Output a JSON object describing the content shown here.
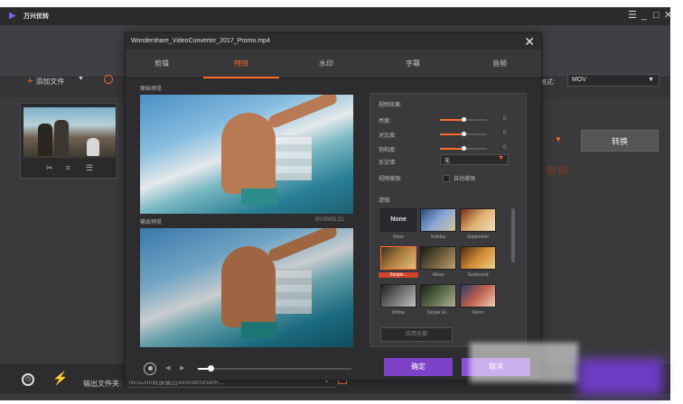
{
  "app": {
    "title": "万兴优转",
    "window_controls": {
      "menu": "☰",
      "minimize": "_",
      "maximize": "□",
      "close": "✕"
    }
  },
  "toolbar": {
    "add_file": "添加文件",
    "output_format_label": "格式:",
    "output_format_value": "MOV"
  },
  "file_item": {
    "convert_label": "转换"
  },
  "bottom": {
    "output_label": "输出文件夹:",
    "output_path": "\\WSOut\\转换输出\\Wondershare\\..."
  },
  "dialog": {
    "title": "Wondershare_VideoConverter_2017_Promo.mp4",
    "close": "✕",
    "tabs": [
      "剪辑",
      "特效",
      "水印",
      "字幕",
      "音频"
    ],
    "original_preview_label": "原始预览",
    "output_preview_label": "输出预览",
    "output_time": "00:00/01:21",
    "playback_progress": 0.08,
    "video_effects_label": "视频效果:",
    "adjustments": [
      {
        "label": "亮度:",
        "value": "0",
        "level": 0.5
      },
      {
        "label": "对比度:",
        "value": "0",
        "level": 0.5
      },
      {
        "label": "饱和度:",
        "value": "0",
        "level": 0.5
      }
    ],
    "deinterlace_label": "反交错:",
    "deinterlace_value": "无",
    "enhance_label": "视频增强:",
    "auto_enhance_label": "自动增强",
    "filter_label": "滤镜:",
    "filters": [
      {
        "name": "None",
        "style": "none"
      },
      {
        "name": "Holiday",
        "style": "holiday"
      },
      {
        "name": "September",
        "style": "september"
      },
      {
        "name": "Simple...",
        "style": "simple",
        "selected": true
      },
      {
        "name": "Aibao",
        "style": "aibao"
      },
      {
        "name": "Sunkissed",
        "style": "sunkissed"
      },
      {
        "name": "Willow",
        "style": "willow"
      },
      {
        "name": "Simple El...",
        "style": "simpleel"
      },
      {
        "name": "Retro",
        "style": "retro"
      }
    ],
    "apply_all_label": "应用全部",
    "ok_label": "确定",
    "cancel_label": "取消",
    "colors": {
      "accent": "#ff6a2c",
      "primary": "#7c43c9"
    }
  }
}
